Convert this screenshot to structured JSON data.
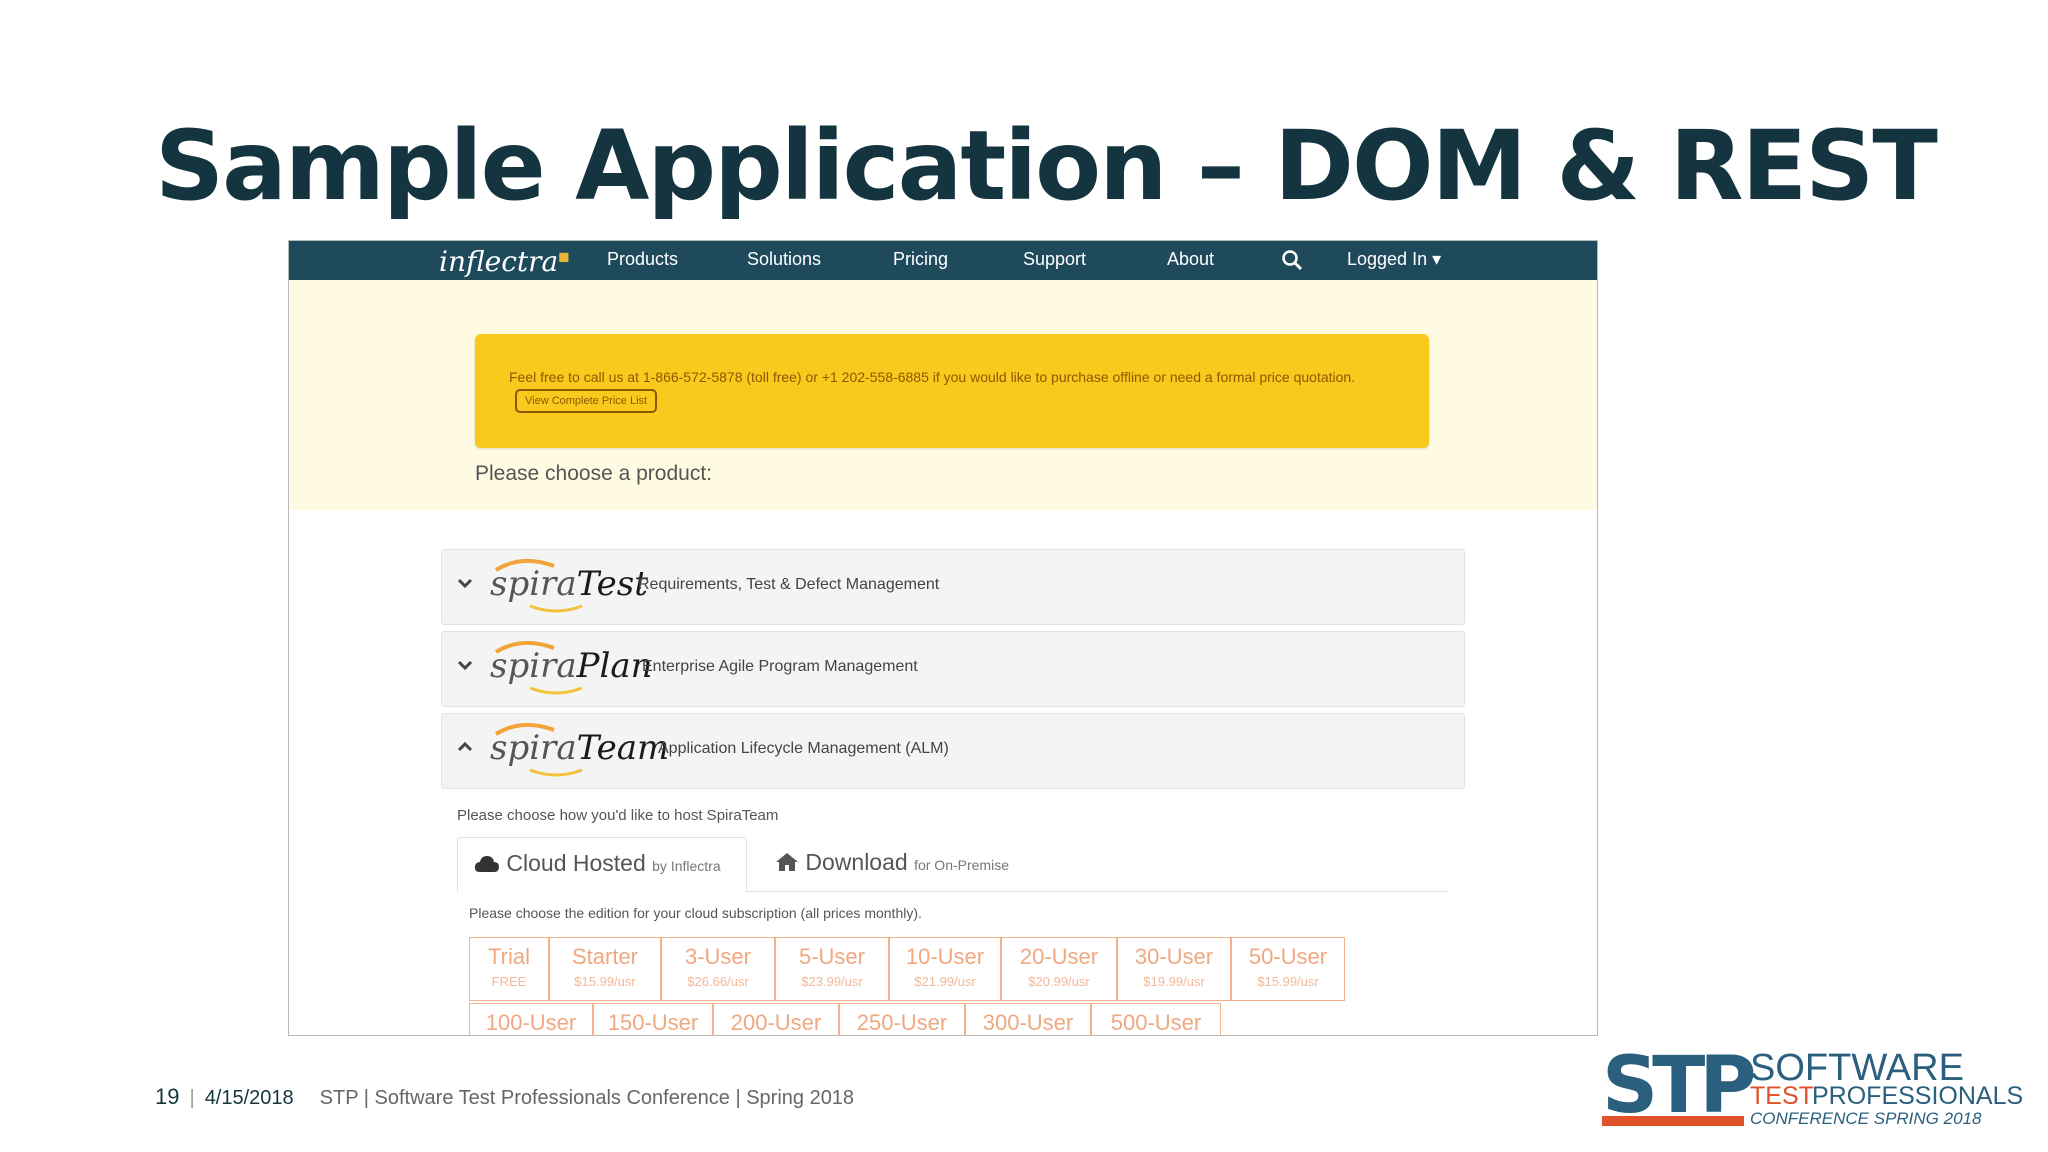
{
  "slide": {
    "title": "Sample Application – DOM & REST",
    "footer": {
      "page_number": "19",
      "separator": "|",
      "date": "4/15/2018",
      "conference": "STP | Software Test Professionals Conference | Spring 2018"
    },
    "logo": {
      "line1": "SOFTWARE",
      "line2_a": "TEST",
      "line2_b": "PROFESSIONALS",
      "line3": "CONFERENCE SPRING 2018"
    }
  },
  "app": {
    "logo_text": "inflectra",
    "nav": {
      "items": [
        "Products",
        "Solutions",
        "Pricing",
        "Support",
        "About"
      ],
      "search_icon": "search-icon",
      "account_label": "Logged In"
    },
    "notice": {
      "text": "Feel free to call us at 1-866-572-5878 (toll free) or +1 202-558-6885 if you would like to purchase offline or need a formal price quotation.",
      "button_label": "View Complete Price List"
    },
    "choose_product": "Please choose a product:",
    "products": [
      {
        "prefix": "spira",
        "brand": "Test",
        "description": "Requirements, Test & Defect Management",
        "state": "collapsed"
      },
      {
        "prefix": "spira",
        "brand": "Plan",
        "description": "Enterprise Agile Program Management",
        "state": "collapsed"
      },
      {
        "prefix": "spira",
        "brand": "Team",
        "description": "Application Lifecycle Management (ALM)",
        "state": "expanded"
      }
    ],
    "hosting_question": "Please choose how you'd like to host SpiraTeam",
    "tabs": [
      {
        "label": "Cloud Hosted",
        "sub": "by Inflectra",
        "icon": "cloud-icon",
        "active": true
      },
      {
        "label": "Download",
        "sub": "for On-Premise",
        "icon": "home-icon",
        "active": false
      }
    ],
    "edition_question": "Please choose the edition for your cloud subscription (all prices monthly).",
    "editions_row1": [
      {
        "name": "Trial",
        "price": "FREE"
      },
      {
        "name": "Starter",
        "price": "$15.99/usr"
      },
      {
        "name": "3-User",
        "price": "$26.66/usr"
      },
      {
        "name": "5-User",
        "price": "$23.99/usr"
      },
      {
        "name": "10-User",
        "price": "$21.99/usr"
      },
      {
        "name": "20-User",
        "price": "$20.99/usr"
      },
      {
        "name": "30-User",
        "price": "$19.99/usr"
      },
      {
        "name": "50-User",
        "price": "$15.99/usr"
      }
    ],
    "editions_row2": [
      {
        "name": "100-User"
      },
      {
        "name": "150-User"
      },
      {
        "name": "200-User"
      },
      {
        "name": "250-User"
      },
      {
        "name": "300-User"
      },
      {
        "name": "500-User"
      }
    ],
    "colors": {
      "nav_bg": "#1e4a5b",
      "notice_bg": "#f9c91e",
      "hero_bg": "#fffbe3",
      "edition_accent": "#f0a880",
      "title": "#14353f"
    }
  }
}
